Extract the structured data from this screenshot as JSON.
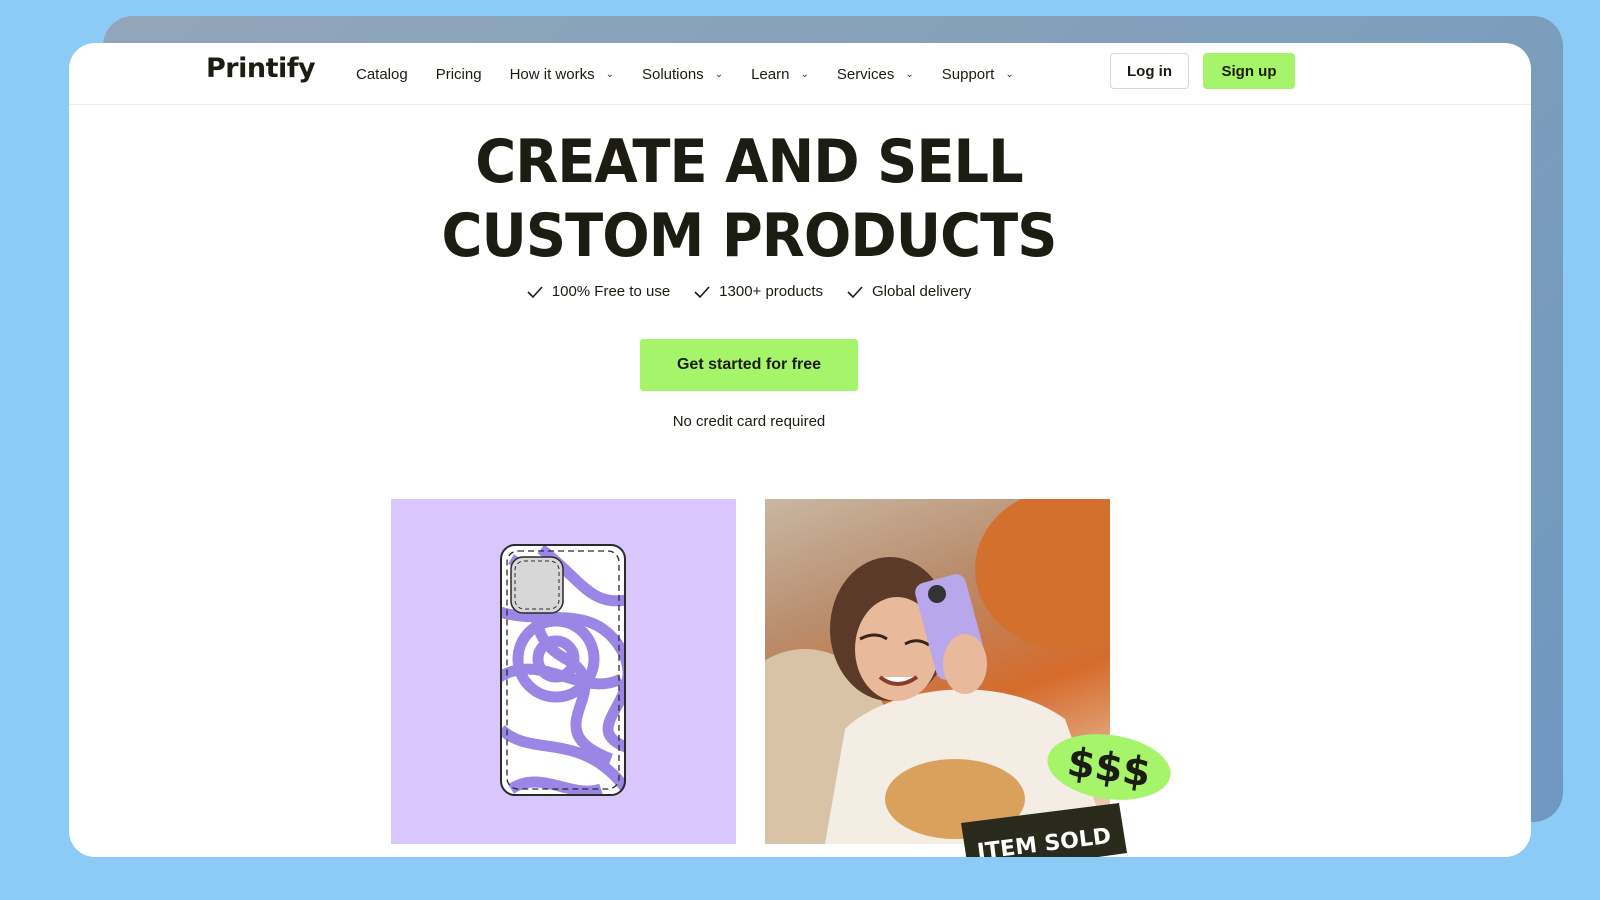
{
  "brand": {
    "logo_text": "Printify"
  },
  "nav": {
    "items": [
      {
        "label": "Catalog",
        "has_dropdown": false
      },
      {
        "label": "Pricing",
        "has_dropdown": false
      },
      {
        "label": "How it works",
        "has_dropdown": true
      },
      {
        "label": "Solutions",
        "has_dropdown": true
      },
      {
        "label": "Learn",
        "has_dropdown": true
      },
      {
        "label": "Services",
        "has_dropdown": true
      },
      {
        "label": "Support",
        "has_dropdown": true
      }
    ],
    "login_label": "Log in",
    "signup_label": "Sign up"
  },
  "hero": {
    "title_line1": "CREATE AND SELL",
    "title_line2": "CUSTOM PRODUCTS",
    "features": [
      "100% Free to use",
      "1300+ products",
      "Global delivery"
    ],
    "cta_label": "Get started for free",
    "cta_note": "No credit card required"
  },
  "showcase": {
    "badge_price": "$$$",
    "badge_label": "ITEM SOLD"
  },
  "colors": {
    "accent": "#a6f46a",
    "text": "#1c1c12",
    "product_bg": "#d9c6fc",
    "page_bg": "#8ccbf5"
  }
}
